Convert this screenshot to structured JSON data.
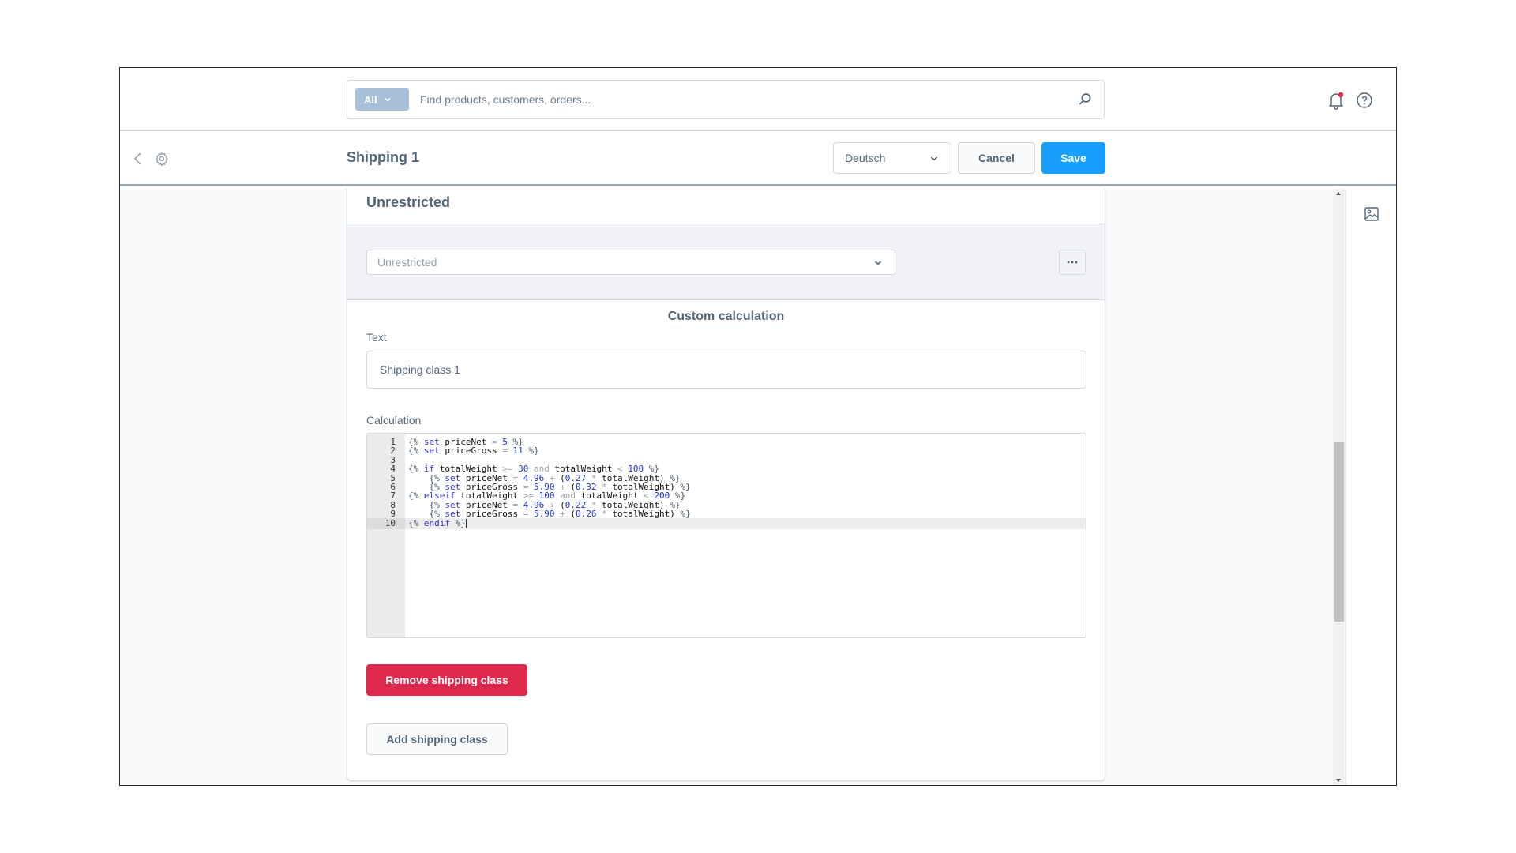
{
  "topbar": {
    "search_type": "All",
    "search_placeholder": "Find products, customers, orders...",
    "search_value": "",
    "notification_dot_color": "#de294c"
  },
  "smartbar": {
    "title": "Shipping 1",
    "language": "Deutsch",
    "cancel_label": "Cancel",
    "save_label": "Save"
  },
  "card": {
    "title": "Unrestricted",
    "rule_select_value": "Unrestricted",
    "ellipsis_label": "...",
    "calc_title": "Custom calculation",
    "text_label": "Text",
    "text_value": "Shipping class 1",
    "calculation_label": "Calculation",
    "remove_label": "Remove shipping class",
    "add_label": "Add shipping class"
  },
  "editor": {
    "active_line": 10,
    "lines": [
      {
        "n": "1",
        "tokens": [
          [
            "delim",
            "{% "
          ],
          [
            "kw",
            "set"
          ],
          [
            "var",
            " priceNet "
          ],
          [
            "op",
            "="
          ],
          [
            "var",
            " "
          ],
          [
            "num",
            "5"
          ],
          [
            "delim",
            " %}"
          ]
        ]
      },
      {
        "n": "2",
        "tokens": [
          [
            "delim",
            "{% "
          ],
          [
            "kw",
            "set"
          ],
          [
            "var",
            " priceGross "
          ],
          [
            "op",
            "="
          ],
          [
            "var",
            " "
          ],
          [
            "num",
            "11"
          ],
          [
            "delim",
            " %}"
          ]
        ]
      },
      {
        "n": "3",
        "tokens": []
      },
      {
        "n": "4",
        "tokens": [
          [
            "delim",
            "{% "
          ],
          [
            "kw",
            "if"
          ],
          [
            "var",
            " totalWeight "
          ],
          [
            "op",
            ">="
          ],
          [
            "var",
            " "
          ],
          [
            "num",
            "30"
          ],
          [
            "op",
            " and "
          ],
          [
            "var",
            "totalWeight "
          ],
          [
            "op",
            "<"
          ],
          [
            "var",
            " "
          ],
          [
            "num",
            "100"
          ],
          [
            "delim",
            " %}"
          ]
        ]
      },
      {
        "n": "5",
        "tokens": [
          [
            "var",
            "    "
          ],
          [
            "delim",
            "{% "
          ],
          [
            "kw",
            "set"
          ],
          [
            "var",
            " priceNet "
          ],
          [
            "op",
            "="
          ],
          [
            "var",
            " "
          ],
          [
            "num",
            "4.96"
          ],
          [
            "op",
            " + "
          ],
          [
            "var",
            "("
          ],
          [
            "num",
            "0.27"
          ],
          [
            "op",
            " * "
          ],
          [
            "var",
            "totalWeight) "
          ],
          [
            "delim",
            "%}"
          ]
        ]
      },
      {
        "n": "6",
        "tokens": [
          [
            "var",
            "    "
          ],
          [
            "delim",
            "{% "
          ],
          [
            "kw",
            "set"
          ],
          [
            "var",
            " priceGross "
          ],
          [
            "op",
            "="
          ],
          [
            "var",
            " "
          ],
          [
            "num",
            "5.90"
          ],
          [
            "op",
            " + "
          ],
          [
            "var",
            "("
          ],
          [
            "num",
            "0.32"
          ],
          [
            "op",
            " * "
          ],
          [
            "var",
            "totalWeight) "
          ],
          [
            "delim",
            "%}"
          ]
        ]
      },
      {
        "n": "7",
        "tokens": [
          [
            "delim",
            "{% "
          ],
          [
            "kw",
            "elseif"
          ],
          [
            "var",
            " totalWeight "
          ],
          [
            "op",
            ">="
          ],
          [
            "var",
            " "
          ],
          [
            "num",
            "100"
          ],
          [
            "op",
            " and "
          ],
          [
            "var",
            "totalWeight "
          ],
          [
            "op",
            "<"
          ],
          [
            "var",
            " "
          ],
          [
            "num",
            "200"
          ],
          [
            "delim",
            " %}"
          ]
        ]
      },
      {
        "n": "8",
        "tokens": [
          [
            "var",
            "    "
          ],
          [
            "delim",
            "{% "
          ],
          [
            "kw",
            "set"
          ],
          [
            "var",
            " priceNet "
          ],
          [
            "op",
            "="
          ],
          [
            "var",
            " "
          ],
          [
            "num",
            "4.96"
          ],
          [
            "op",
            " + "
          ],
          [
            "var",
            "("
          ],
          [
            "num",
            "0.22"
          ],
          [
            "op",
            " * "
          ],
          [
            "var",
            "totalWeight) "
          ],
          [
            "delim",
            "%}"
          ]
        ]
      },
      {
        "n": "9",
        "tokens": [
          [
            "var",
            "    "
          ],
          [
            "delim",
            "{% "
          ],
          [
            "kw",
            "set"
          ],
          [
            "var",
            " priceGross "
          ],
          [
            "op",
            "="
          ],
          [
            "var",
            " "
          ],
          [
            "num",
            "5.90"
          ],
          [
            "op",
            " + "
          ],
          [
            "var",
            "("
          ],
          [
            "num",
            "0.26"
          ],
          [
            "op",
            " * "
          ],
          [
            "var",
            "totalWeight) "
          ],
          [
            "delim",
            "%}"
          ]
        ]
      },
      {
        "n": "10",
        "tokens": [
          [
            "delim",
            "{% "
          ],
          [
            "kw",
            "endif"
          ],
          [
            "delim",
            " %}"
          ]
        ]
      }
    ]
  },
  "colors": {
    "primary": "#189eff",
    "danger": "#de294c",
    "text": "#52667a"
  },
  "scroll": {
    "position_fraction": 0.61,
    "visible_fraction": 0.31
  }
}
